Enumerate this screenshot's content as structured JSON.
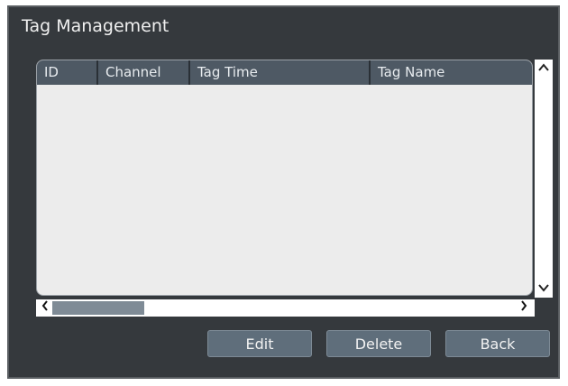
{
  "dialog": {
    "title": "Tag Management"
  },
  "table": {
    "columns": [
      "ID",
      "Channel",
      "Tag Time",
      "Tag Name"
    ],
    "rows": []
  },
  "scrollbars": {
    "vertical": {
      "up_icon": "chevron-up-icon",
      "down_icon": "chevron-down-icon"
    },
    "horizontal": {
      "left_icon": "chevron-left-icon",
      "right_icon": "chevron-right-icon"
    }
  },
  "buttons": {
    "edit": "Edit",
    "delete": "Delete",
    "back": "Back"
  },
  "colors": {
    "dialog_bg": "#35393d",
    "header_bg": "#4e5964",
    "table_bg": "#ececec",
    "button_bg": "#5f6e7b",
    "scroll_thumb": "#7f8b96"
  }
}
